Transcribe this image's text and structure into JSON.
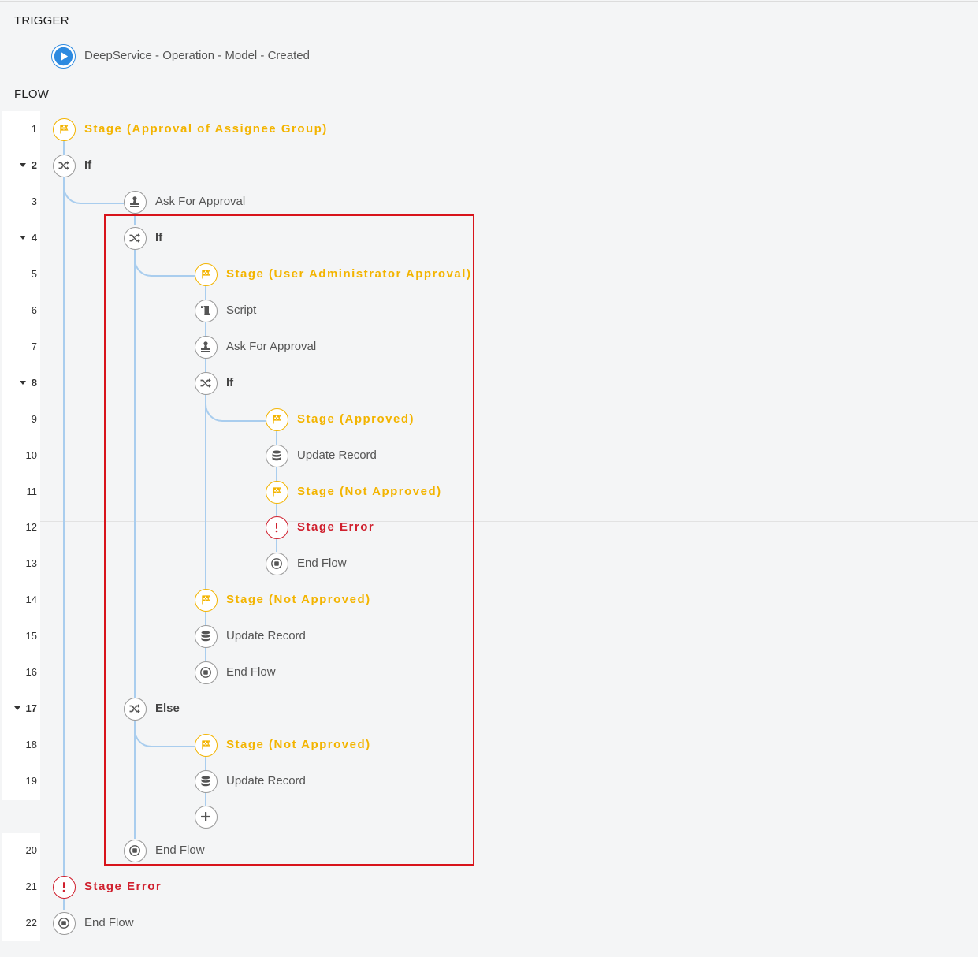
{
  "trigger": {
    "heading": "TRIGGER",
    "name": "DeepService - Operation - Model - Created",
    "icon": "play-icon"
  },
  "flow": {
    "heading": "FLOW",
    "rows": [
      {
        "n": "1",
        "label": "Stage (Approval of Assignee Group)",
        "kind": "stage",
        "icon": "flag-icon"
      },
      {
        "n": "2",
        "label": "If",
        "kind": "branch",
        "icon": "shuffle-icon",
        "collapsible": true
      },
      {
        "n": "3",
        "label": "Ask For Approval",
        "kind": "action",
        "icon": "stamp-icon"
      },
      {
        "n": "4",
        "label": "If",
        "kind": "branch",
        "icon": "shuffle-icon",
        "collapsible": true
      },
      {
        "n": "5",
        "label": "Stage (User Administrator Approval)",
        "kind": "stage",
        "icon": "flag-icon"
      },
      {
        "n": "6",
        "label": "Script",
        "kind": "action",
        "icon": "script-icon"
      },
      {
        "n": "7",
        "label": "Ask For Approval",
        "kind": "action",
        "icon": "stamp-icon"
      },
      {
        "n": "8",
        "label": "If",
        "kind": "branch",
        "icon": "shuffle-icon",
        "collapsible": true
      },
      {
        "n": "9",
        "label": "Stage (Approved)",
        "kind": "stage",
        "icon": "flag-icon"
      },
      {
        "n": "10",
        "label": "Update Record",
        "kind": "action",
        "icon": "database-icon"
      },
      {
        "n": "11",
        "label": "Stage (Not Approved)",
        "kind": "stage",
        "icon": "flag-icon"
      },
      {
        "n": "12",
        "label": "Stage Error",
        "kind": "error",
        "icon": "alert-icon"
      },
      {
        "n": "13",
        "label": "End Flow",
        "kind": "action",
        "icon": "stop-icon"
      },
      {
        "n": "14",
        "label": "Stage (Not Approved)",
        "kind": "stage",
        "icon": "flag-icon"
      },
      {
        "n": "15",
        "label": "Update Record",
        "kind": "action",
        "icon": "database-icon"
      },
      {
        "n": "16",
        "label": "End Flow",
        "kind": "action",
        "icon": "stop-icon"
      },
      {
        "n": "17",
        "label": "Else",
        "kind": "branch",
        "icon": "shuffle-icon",
        "collapsible": true
      },
      {
        "n": "18",
        "label": "Stage (Not Approved)",
        "kind": "stage",
        "icon": "flag-icon"
      },
      {
        "n": "19",
        "label": "Update Record",
        "kind": "action",
        "icon": "database-icon"
      },
      {
        "n": "",
        "label": "",
        "kind": "add",
        "icon": "plus-icon"
      },
      {
        "n": "20",
        "label": "End Flow",
        "kind": "action",
        "icon": "stop-icon"
      },
      {
        "n": "21",
        "label": "Stage Error",
        "kind": "error",
        "icon": "alert-icon"
      },
      {
        "n": "22",
        "label": "End Flow",
        "kind": "action",
        "icon": "stop-icon"
      }
    ]
  },
  "colors": {
    "stage": "#f3b400",
    "error": "#d0202e",
    "connector": "#a9cdee",
    "highlight": "#d8141b",
    "trigger": "#2d8ae0"
  }
}
